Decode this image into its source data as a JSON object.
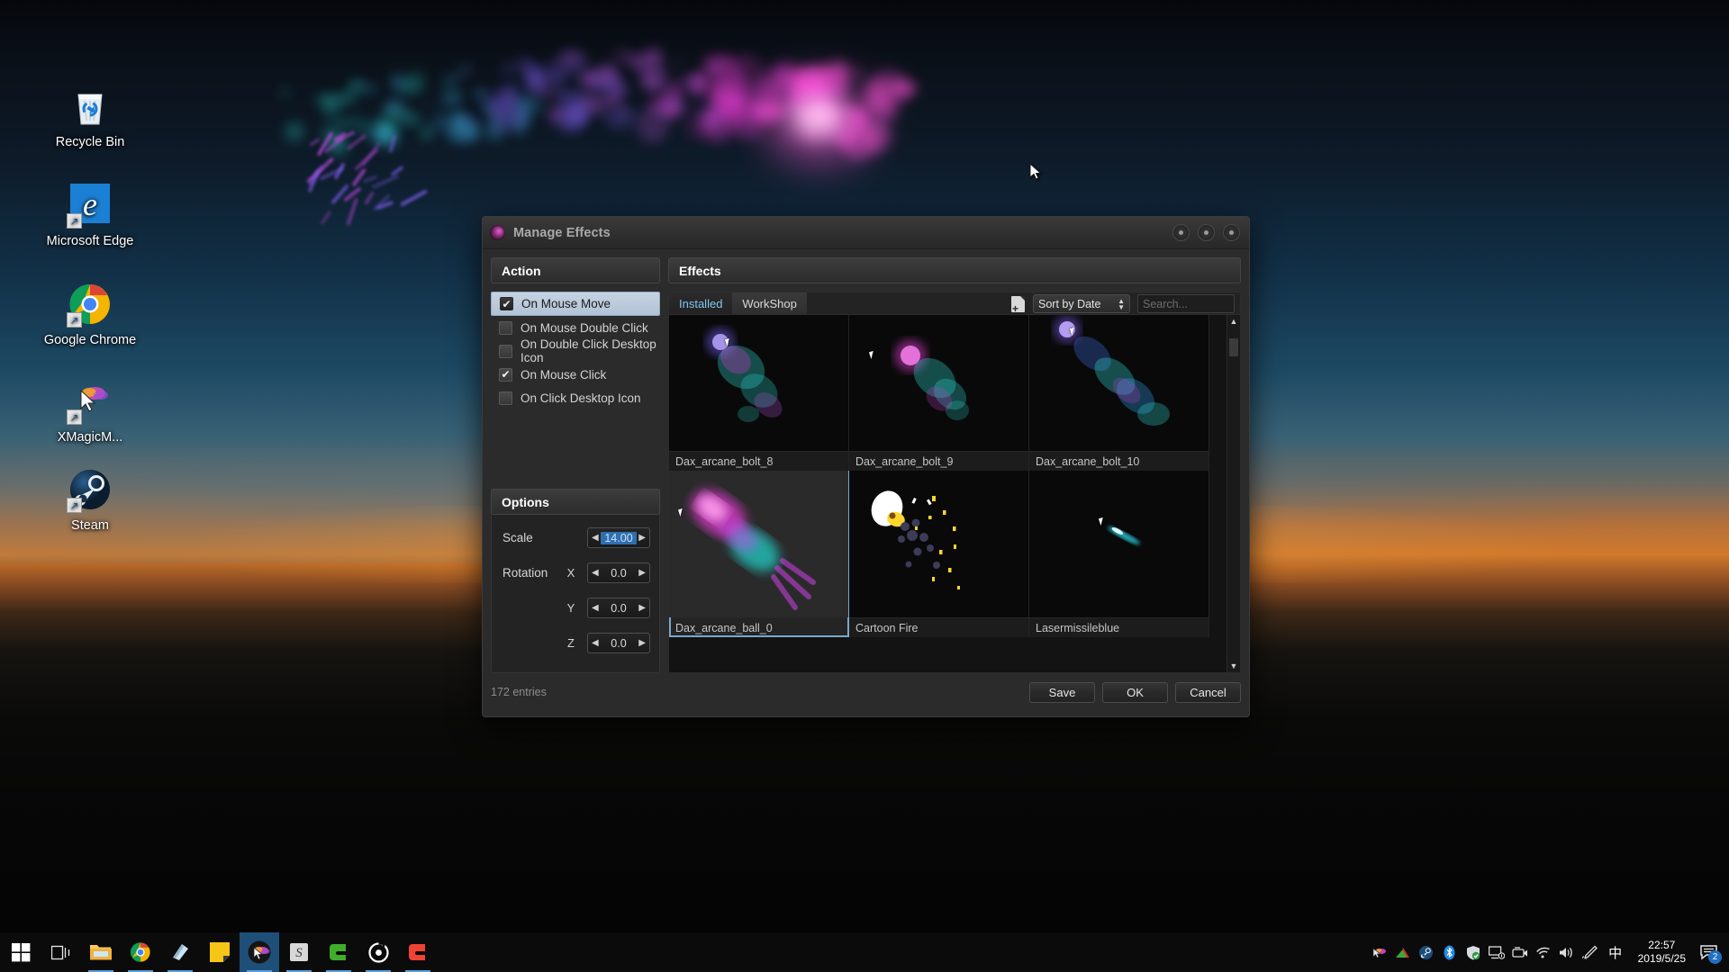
{
  "desktop": {
    "icons": [
      {
        "label": "Recycle Bin",
        "icon": "recycle-bin-icon",
        "shortcut": false
      },
      {
        "label": "Microsoft Edge",
        "icon": "microsoft-edge-icon",
        "shortcut": true
      },
      {
        "label": "Google Chrome",
        "icon": "google-chrome-icon",
        "shortcut": true
      },
      {
        "label": "XMagicM...",
        "icon": "xmagicmouse-icon",
        "shortcut": true
      },
      {
        "label": "Steam",
        "icon": "steam-icon",
        "shortcut": true
      }
    ]
  },
  "dialog": {
    "title": "Manage Effects",
    "title_icon": "app-icon",
    "window_buttons": [
      "minimize-button",
      "maximize-button",
      "close-button"
    ],
    "action": {
      "header": "Action",
      "items": [
        {
          "label": "On Mouse Move",
          "checked": true,
          "selected": true
        },
        {
          "label": "On Mouse Double Click",
          "checked": false,
          "selected": false
        },
        {
          "label": "On Double Click Desktop Icon",
          "checked": false,
          "selected": false
        },
        {
          "label": "On Mouse Click",
          "checked": true,
          "selected": false
        },
        {
          "label": "On Click Desktop Icon",
          "checked": false,
          "selected": false
        }
      ]
    },
    "options": {
      "header": "Options",
      "scale_label": "Scale",
      "scale_value": "14.00",
      "scale_selected": true,
      "rotation_label": "Rotation",
      "rotation": [
        {
          "axis": "X",
          "value": "0.0"
        },
        {
          "axis": "Y",
          "value": "0.0"
        },
        {
          "axis": "Z",
          "value": "0.0"
        }
      ],
      "left_arrow": "◀",
      "right_arrow": "▶"
    },
    "effects": {
      "header": "Effects",
      "tabs": [
        {
          "label": "Installed",
          "active": true
        },
        {
          "label": "WorkShop",
          "active": false
        }
      ],
      "add_icon": "add-file-icon",
      "sort_value": "Sort by Date",
      "search_placeholder": "Search...",
      "search_value": "",
      "search_icon": "search-icon",
      "scrollbar": {
        "up": "▲",
        "down": "▼"
      },
      "grid": [
        {
          "label": "Dax_arcane_bolt_8",
          "selected": false,
          "art": "arcane-bolt"
        },
        {
          "label": "Dax_arcane_bolt_9",
          "selected": false,
          "art": "arcane-bolt"
        },
        {
          "label": "Dax_arcane_bolt_10",
          "selected": false,
          "art": "arcane-bolt"
        },
        {
          "label": "Dax_arcane_ball_0",
          "selected": true,
          "art": "arcane-ball"
        },
        {
          "label": "Cartoon Fire",
          "selected": false,
          "art": "cartoon-fire"
        },
        {
          "label": "Lasermissileblue",
          "selected": false,
          "art": "laser-missile"
        }
      ]
    },
    "footer": {
      "entries": "172 entries",
      "buttons": [
        {
          "label": "Save",
          "name": "save-button"
        },
        {
          "label": "OK",
          "name": "ok-button"
        },
        {
          "label": "Cancel",
          "name": "cancel-button"
        }
      ]
    }
  },
  "taskbar": {
    "start": "windows-start-icon",
    "items": [
      {
        "name": "task-view-icon",
        "running": false,
        "active": false
      },
      {
        "name": "file-explorer-icon",
        "running": true,
        "active": false
      },
      {
        "name": "google-chrome-icon",
        "running": true,
        "active": false
      },
      {
        "name": "microsoft-edge-icon",
        "running": true,
        "active": false
      },
      {
        "name": "sticky-notes-icon",
        "running": false,
        "active": false
      },
      {
        "name": "xmagicmouse-icon",
        "running": true,
        "active": true
      },
      {
        "name": "sublime-text-icon",
        "running": true,
        "active": false
      },
      {
        "name": "cheat-engine-icon",
        "running": true,
        "active": false
      },
      {
        "name": "target-app-icon",
        "running": true,
        "active": false
      },
      {
        "name": "c-app-icon",
        "running": true,
        "active": false
      }
    ],
    "tray": [
      "xmagicmouse-tray-icon",
      "amd-tray-icon",
      "steam-tray-icon",
      "bluetooth-tray-icon",
      "windows-defender-tray-icon",
      "display-tray-icon",
      "camera-tray-icon",
      "wifi-tray-icon",
      "volume-tray-icon",
      "pen-tray-icon",
      "ime-chinese-tray-icon"
    ],
    "ime_glyph": "中",
    "clock_time": "22:57",
    "clock_date": "2019/5/25",
    "notifications_icon": "action-center-icon",
    "notifications_count": "2"
  },
  "colors": {
    "accent_blue": "#7fc6ef",
    "selection_blue": "#2f6fb0",
    "selected_row": "#b2c3d6",
    "dialog_bg": "#2b2b2b",
    "grid_bg": "#131313"
  }
}
